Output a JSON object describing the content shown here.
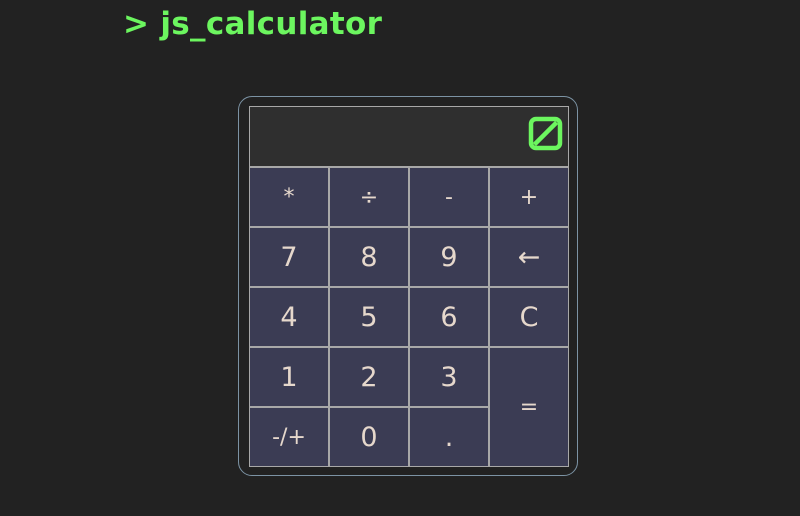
{
  "header": {
    "title": "> js_calculator"
  },
  "display": {
    "value": "",
    "toggle_icon": "slashed-zero-icon"
  },
  "colors": {
    "accent": "#6cf65f",
    "background": "#222222",
    "display_bg": "#2f2f2f",
    "key_bg": "#3b3c54",
    "key_text": "#e6d8cc",
    "border": "#a8a8a8",
    "frame": "#7c93a4"
  },
  "keys": {
    "multiply": "*",
    "divide": "÷",
    "subtract": "-",
    "add": "+",
    "seven": "7",
    "eight": "8",
    "nine": "9",
    "backspace": "←",
    "four": "4",
    "five": "5",
    "six": "6",
    "clear": "C",
    "one": "1",
    "two": "2",
    "three": "3",
    "equals": "=",
    "negate": "-/+",
    "zero": "0",
    "decimal": "."
  }
}
